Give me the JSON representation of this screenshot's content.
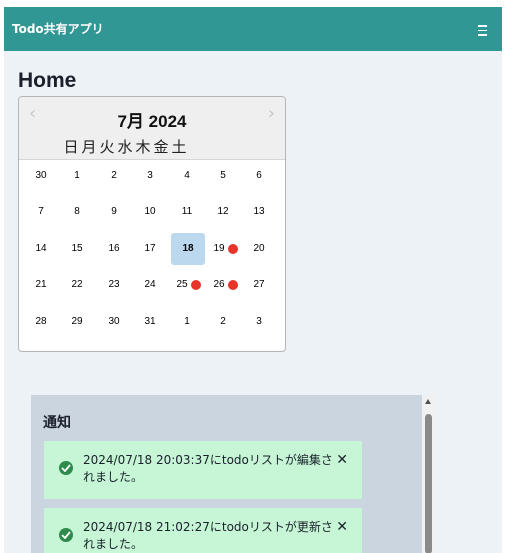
{
  "navbar": {
    "brand": "Todo共有アプリ",
    "menu_icon": "hamburger-icon"
  },
  "page": {
    "title": "Home"
  },
  "calendar": {
    "month_label": "7月 2024",
    "prev_symbol": "‹",
    "next_symbol": "›",
    "weekdays": [
      "日",
      "月",
      "火",
      "水",
      "木",
      "金",
      "土"
    ],
    "weeks": [
      [
        "30",
        "1",
        "2",
        "3",
        "4",
        "5",
        "6"
      ],
      [
        "7",
        "8",
        "9",
        "10",
        "11",
        "12",
        "13"
      ],
      [
        "14",
        "15",
        "16",
        "17",
        "18",
        "19",
        "20"
      ],
      [
        "21",
        "22",
        "23",
        "24",
        "25",
        "26",
        "27"
      ],
      [
        "28",
        "29",
        "30",
        "31",
        "1",
        "2",
        "3"
      ]
    ],
    "today": "18",
    "event_color": "#e8332a"
  },
  "notifications": {
    "title": "通知",
    "items": [
      {
        "text": "2024/07/18 20:03:37にtodoリストが編集されました。",
        "close": "✕"
      },
      {
        "text": "2024/07/18 21:02:27にtodoリストが更新されました。",
        "close": "✕"
      }
    ]
  },
  "colors": {
    "navbar": "#319795",
    "toast": "#c6f6d5",
    "panel": "#cbd5e0"
  }
}
